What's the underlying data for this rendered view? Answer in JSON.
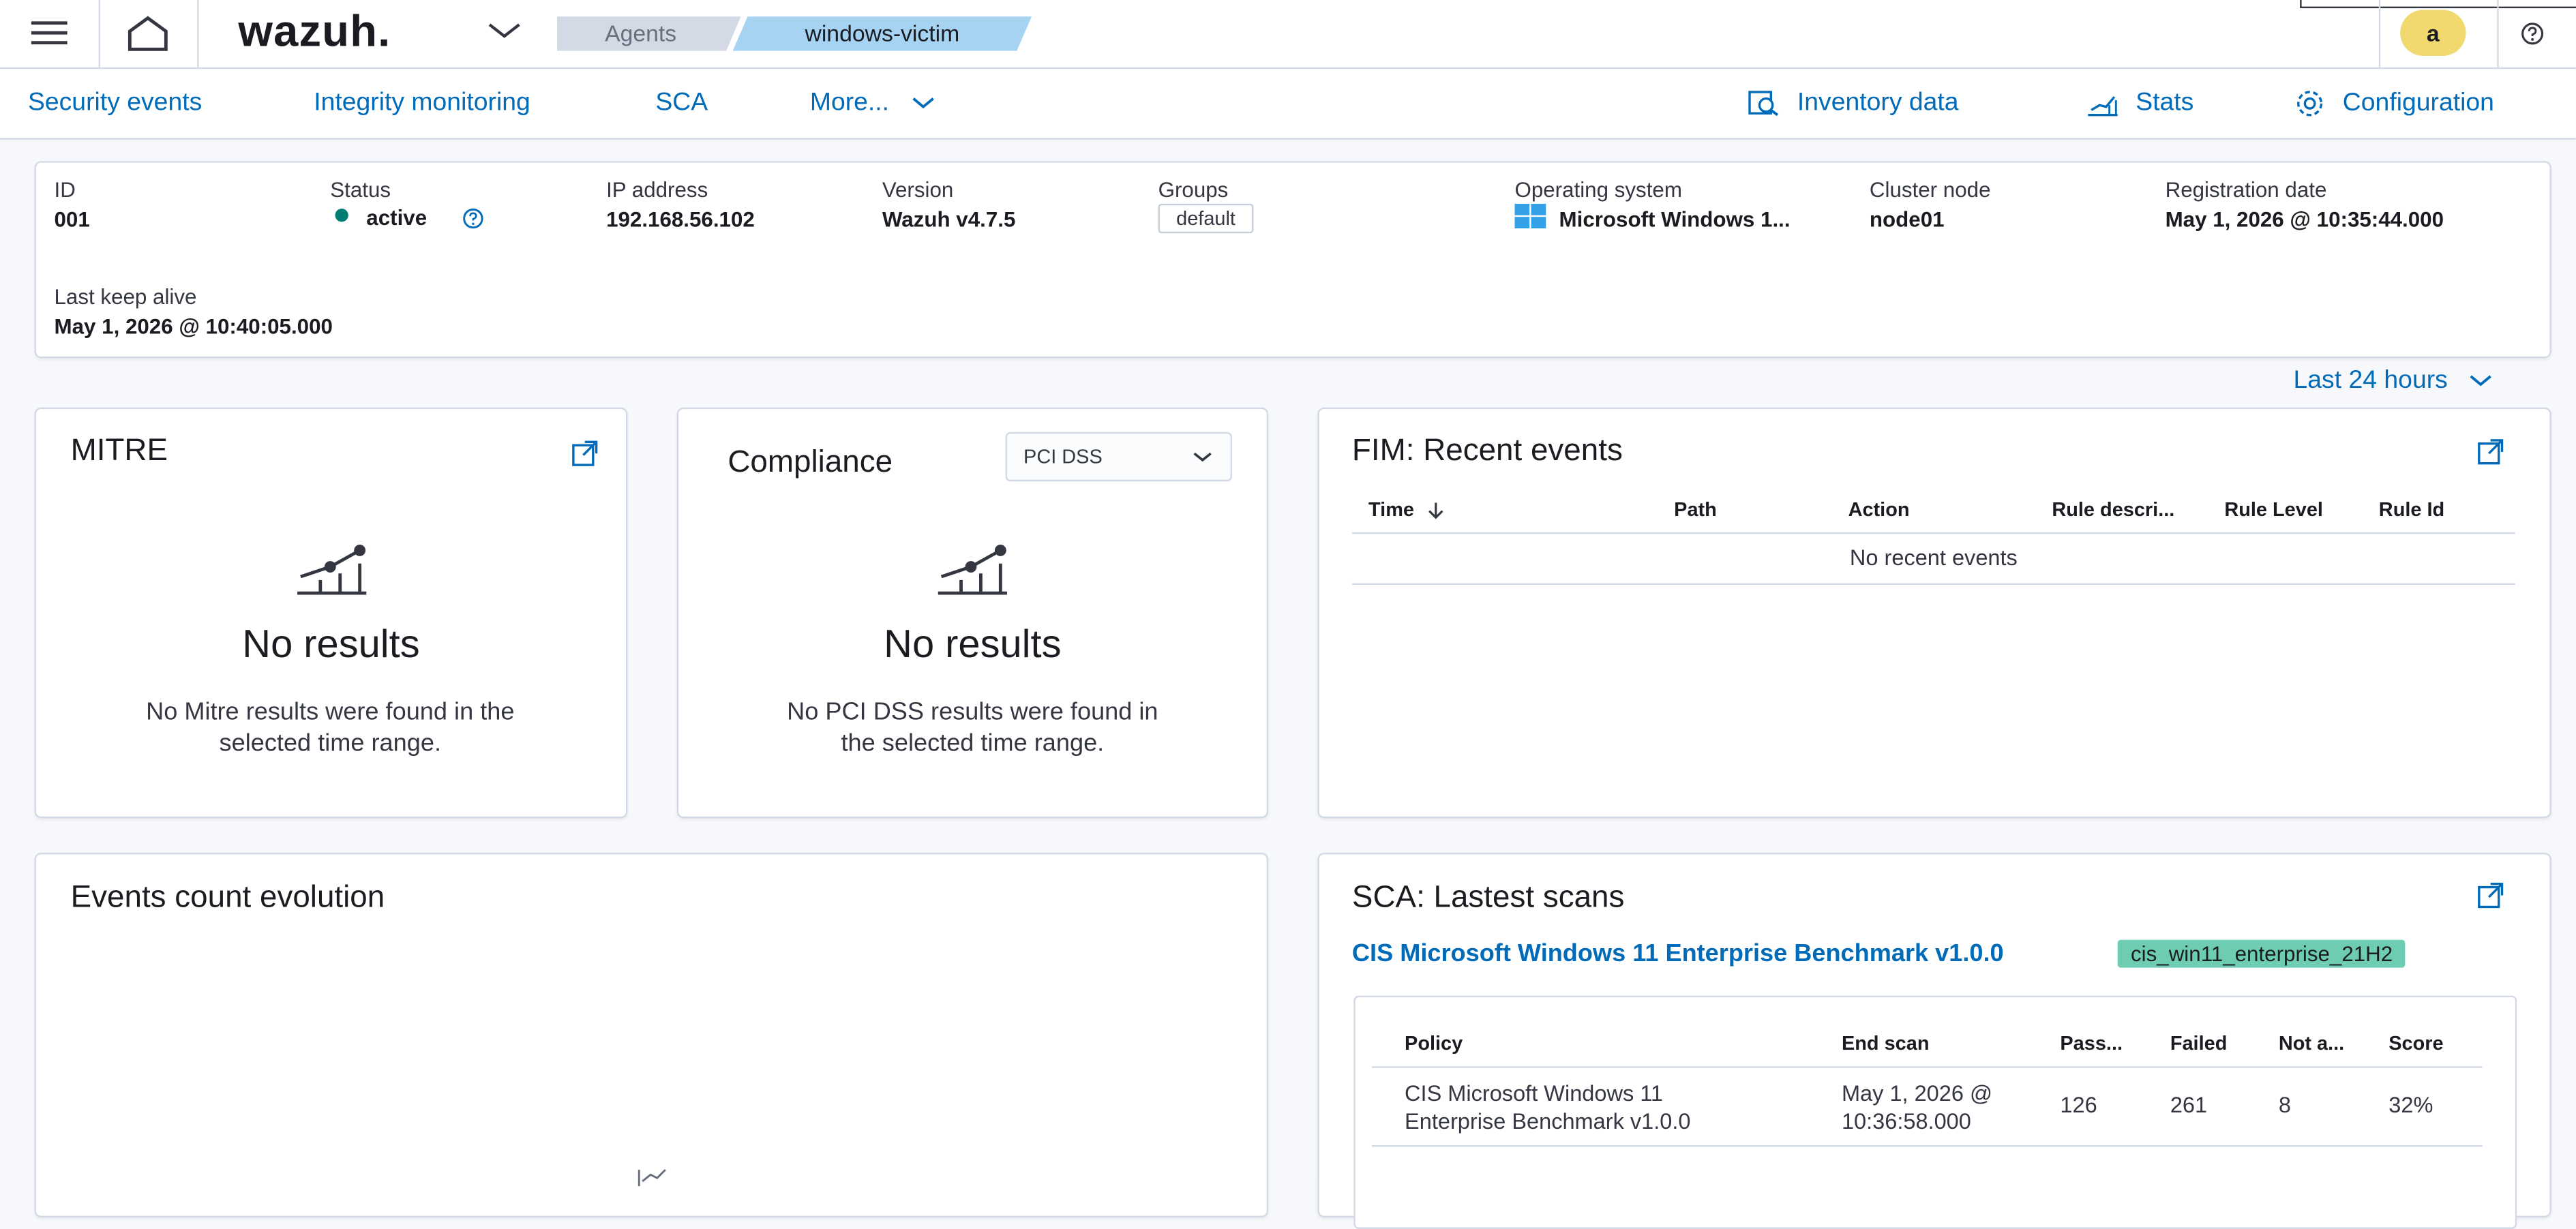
{
  "header": {
    "logo": "wazuh.",
    "breadcrumb": [
      "Agents",
      "windows-victim"
    ],
    "user_initial": "a"
  },
  "nav": {
    "tabs": [
      "Security events",
      "Integrity monitoring",
      "SCA",
      "More..."
    ],
    "actions": [
      "Inventory data",
      "Stats",
      "Configuration"
    ]
  },
  "agent": {
    "id_label": "ID",
    "id": "001",
    "status_label": "Status",
    "status": "active",
    "ip_label": "IP address",
    "ip": "192.168.56.102",
    "version_label": "Version",
    "version": "Wazuh v4.7.5",
    "groups_label": "Groups",
    "group": "default",
    "os_label": "Operating system",
    "os": "Microsoft Windows 1...",
    "cluster_label": "Cluster node",
    "cluster": "node01",
    "reg_label": "Registration date",
    "reg": "May 1, 2026 @ 10:35:44.000",
    "keepalive_label": "Last keep alive",
    "keepalive": "May 1, 2026 @ 10:40:05.000"
  },
  "time_range": "Last 24 hours",
  "mitre": {
    "title": "MITRE",
    "empty_title": "No results",
    "empty_desc": "No Mitre results were found in the selected time range."
  },
  "compliance": {
    "title": "Compliance",
    "selected": "PCI DSS",
    "empty_title": "No results",
    "empty_desc": "No PCI DSS results were found in the selected time range."
  },
  "fim": {
    "title": "FIM: Recent events",
    "columns": [
      "Time",
      "Path",
      "Action",
      "Rule descri...",
      "Rule Level",
      "Rule Id"
    ],
    "empty": "No recent events"
  },
  "events": {
    "title": "Events count evolution"
  },
  "sca": {
    "title": "SCA: Lastest scans",
    "benchmark": "CIS Microsoft Windows 11 Enterprise Benchmark v1.0.0",
    "badge": "cis_win11_enterprise_21H2",
    "columns": [
      "Policy",
      "End scan",
      "Pass...",
      "Failed",
      "Not a...",
      "Score"
    ],
    "row": {
      "policy_line1": "CIS Microsoft Windows 11",
      "policy_line2": "Enterprise Benchmark v1.0.0",
      "end_line1": "May 1, 2026 @",
      "end_line2": "10:36:58.000",
      "pass": "126",
      "failed": "261",
      "na": "8",
      "score": "32%"
    }
  },
  "colors": {
    "link": "#006bb8",
    "active": "#017d73",
    "badge_bg": "#6dccb1",
    "avatar": "#f1d86f",
    "breadcrumb_active": "#a6d3f2",
    "breadcrumb_inactive": "#d3dae6"
  }
}
